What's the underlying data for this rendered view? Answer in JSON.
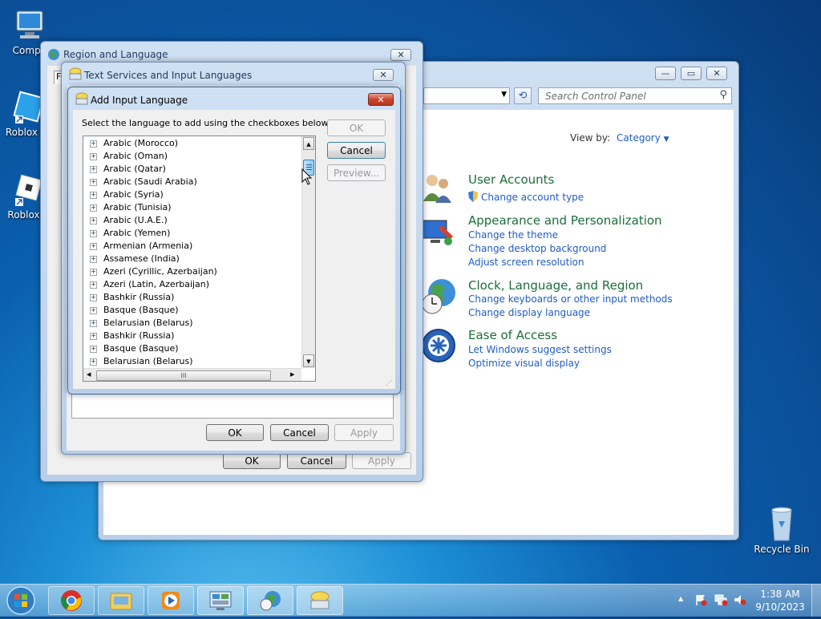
{
  "desktop": {
    "icons": [
      {
        "label": "Compu",
        "icon": "computer-icon"
      },
      {
        "label": "Roblox St",
        "icon": "roblox-studio-icon"
      },
      {
        "label": "Roblox P",
        "icon": "roblox-player-icon"
      },
      {
        "label": "Recycle Bin",
        "icon": "recycle-bin-icon"
      }
    ]
  },
  "control_panel": {
    "search_placeholder": "Search Control Panel",
    "view_by_label": "View by:",
    "view_by_value": "Category",
    "sections": [
      {
        "title": "User Accounts",
        "links": [
          "Change account type"
        ]
      },
      {
        "title": "Appearance and Personalization",
        "links": [
          "Change the theme",
          "Change desktop background",
          "Adjust screen resolution"
        ]
      },
      {
        "title": "Clock, Language, and Region",
        "links": [
          "Change keyboards or other input methods",
          "Change display language"
        ]
      },
      {
        "title": "Ease of Access",
        "links": [
          "Let Windows suggest settings",
          "Optimize visual display"
        ]
      }
    ]
  },
  "region_dialog": {
    "title": "Region and Language",
    "tab_stub": "F",
    "ok": "OK",
    "cancel": "Cancel",
    "apply": "Apply"
  },
  "text_services_dialog": {
    "title": "Text Services and Input Languages",
    "ok": "OK",
    "cancel": "Cancel",
    "apply": "Apply"
  },
  "add_input_dialog": {
    "title": "Add Input Language",
    "instruction": "Select the language to add using the checkboxes below.",
    "ok": "OK",
    "cancel": "Cancel",
    "preview": "Preview...",
    "languages": [
      "Arabic (Morocco)",
      "Arabic (Oman)",
      "Arabic (Qatar)",
      "Arabic (Saudi Arabia)",
      "Arabic (Syria)",
      "Arabic (Tunisia)",
      "Arabic (U.A.E.)",
      "Arabic (Yemen)",
      "Armenian (Armenia)",
      "Assamese (India)",
      "Azeri (Cyrillic, Azerbaijan)",
      "Azeri (Latin, Azerbaijan)",
      "Bashkir (Russia)",
      "Basque (Basque)",
      "Belarusian (Belarus)",
      "Bashkir (Russia)",
      "Basque (Basque)",
      "Belarusian (Belarus)"
    ],
    "hscroll_grip": "III"
  },
  "taskbar": {
    "time": "1:38 AM",
    "date": "9/10/2023",
    "up_arrow": "▲"
  }
}
